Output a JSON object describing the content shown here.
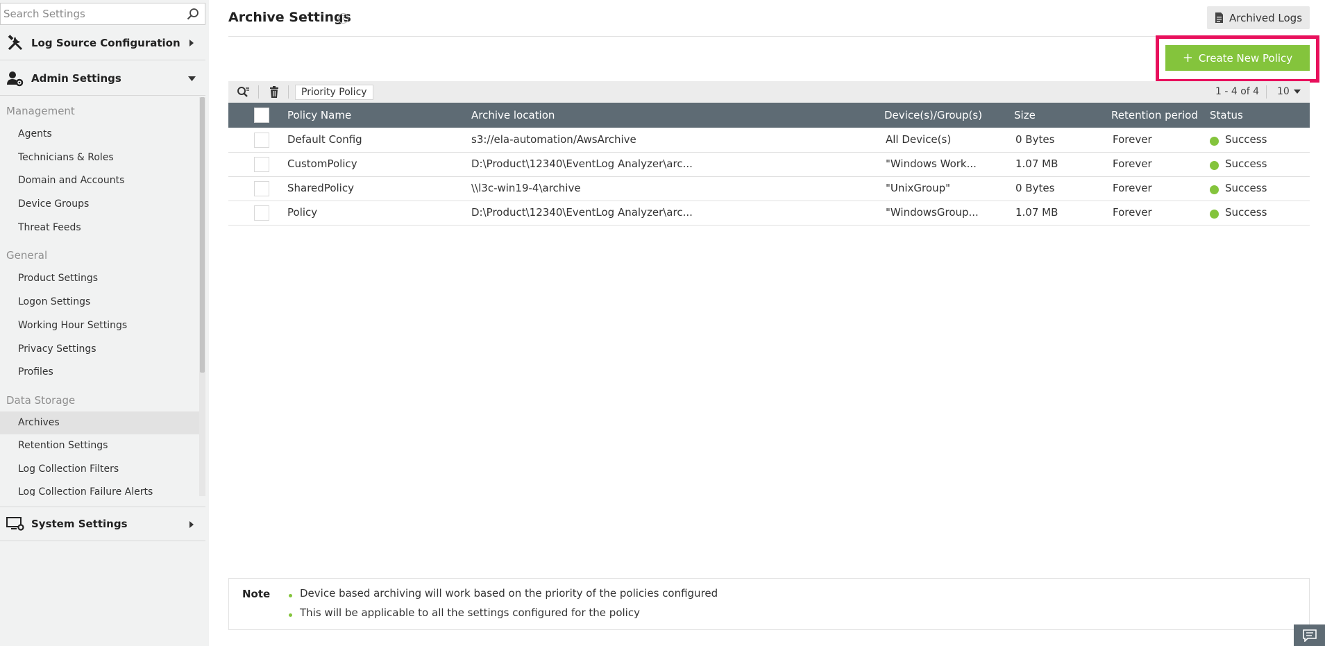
{
  "sidebar": {
    "search_placeholder": "Search Settings",
    "sections": {
      "log_source": "Log Source Configuration",
      "admin": "Admin Settings",
      "system": "System Settings"
    },
    "groups": {
      "management": "Management",
      "general": "General",
      "data_storage": "Data Storage"
    },
    "items": [
      "Agents",
      "Technicians & Roles",
      "Domain and Accounts",
      "Device Groups",
      "Threat Feeds",
      "Product Settings",
      "Logon Settings",
      "Working Hour Settings",
      "Privacy Settings",
      "Profiles",
      "Archives",
      "Retention Settings",
      "Log Collection Filters",
      "Log Collection Failure Alerts"
    ],
    "active_item": "Archives"
  },
  "header": {
    "title": "Archive Settings",
    "help_glyph": "?",
    "archived_logs_label": "Archived Logs"
  },
  "actions": {
    "create_label": "Create New Policy",
    "plus_glyph": "+",
    "priority_label": "Priority Policy"
  },
  "pager": {
    "range": "1 - 4 of 4",
    "page_size": "10"
  },
  "table": {
    "columns": [
      "Policy Name",
      "Archive location",
      "Device(s)/Group(s)",
      "Size",
      "Retention period",
      "Status"
    ],
    "rows": [
      {
        "name": "Default Config",
        "location": "s3://ela-automation/AwsArchive",
        "devices": "All Device(s)",
        "size": "0 Bytes",
        "retention": "Forever",
        "status": "Success"
      },
      {
        "name": "CustomPolicy",
        "location": "D:\\Product\\12340\\EventLog Analyzer\\arc...",
        "devices": "\"Windows Work...",
        "size": "1.07 MB",
        "retention": "Forever",
        "status": "Success"
      },
      {
        "name": "SharedPolicy",
        "location": "\\\\l3c-win19-4\\archive",
        "devices": "\"UnixGroup\"",
        "size": "0 Bytes",
        "retention": "Forever",
        "status": "Success"
      },
      {
        "name": "Policy",
        "location": "D:\\Product\\12340\\EventLog Analyzer\\arc...",
        "devices": "\"WindowsGroup...",
        "size": "1.07 MB",
        "retention": "Forever",
        "status": "Success"
      }
    ]
  },
  "note": {
    "label": "Note",
    "lines": [
      "Device based archiving will work based on the priority of the policies configured",
      "This will be applicable to all the settings configured for the policy"
    ]
  },
  "colors": {
    "accent_green": "#84c43c",
    "highlight": "#e8105c",
    "table_header": "#5e6b74"
  },
  "icons": [
    "search-icon",
    "tools-icon",
    "admin-user-gear-icon",
    "monitor-gear-icon",
    "caret-right-icon",
    "caret-down-icon",
    "document-icon",
    "search-filter-icon",
    "trash-icon",
    "check-circle-icon",
    "chat-icon",
    "help-icon"
  ]
}
